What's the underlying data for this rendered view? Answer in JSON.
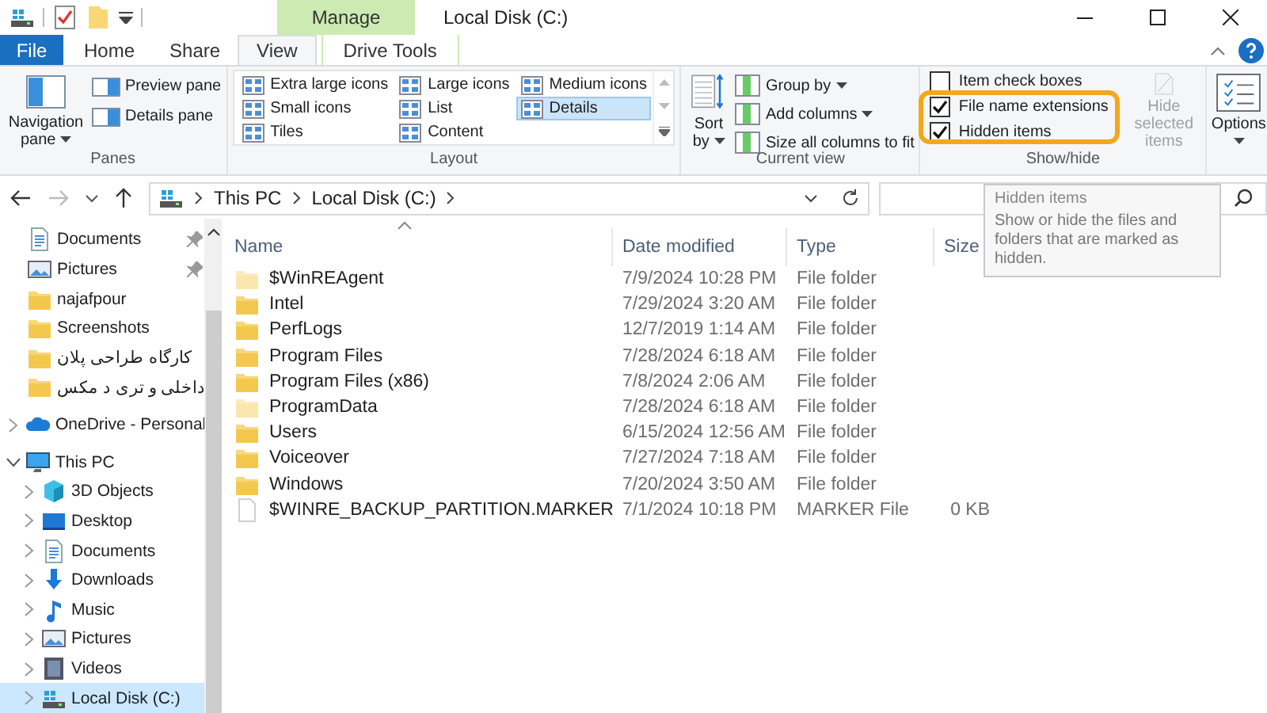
{
  "window": {
    "title": "Local Disk (C:)",
    "context_group": "Manage"
  },
  "tabs": [
    {
      "label": "File",
      "kind": "file",
      "selected": false
    },
    {
      "label": "Home",
      "kind": "normal",
      "selected": false
    },
    {
      "label": "Share",
      "kind": "normal",
      "selected": false
    },
    {
      "label": "View",
      "kind": "normal",
      "selected": true
    },
    {
      "label": "Drive Tools",
      "kind": "context",
      "selected": false
    }
  ],
  "ribbon": {
    "panes": {
      "title": "Panes",
      "large": "Navigation pane",
      "small": [
        "Preview pane",
        "Details pane"
      ]
    },
    "layout": {
      "title": "Layout",
      "options": [
        {
          "label": "Extra large icons",
          "selected": false
        },
        {
          "label": "Large icons",
          "selected": false
        },
        {
          "label": "Medium icons",
          "selected": false
        },
        {
          "label": "Small icons",
          "selected": false
        },
        {
          "label": "List",
          "selected": false
        },
        {
          "label": "Details",
          "selected": true
        },
        {
          "label": "Tiles",
          "selected": false
        },
        {
          "label": "Content",
          "selected": false
        }
      ]
    },
    "current_view": {
      "title": "Current view",
      "large": "Sort by",
      "small": [
        {
          "label": "Group by",
          "dropdown": true
        },
        {
          "label": "Add columns",
          "dropdown": true
        },
        {
          "label": "Size all columns to fit",
          "dropdown": false
        }
      ]
    },
    "show_hide": {
      "title": "Show/hide",
      "checkboxes": [
        {
          "label": "Item check boxes",
          "checked": false
        },
        {
          "label": "File name extensions",
          "checked": true
        },
        {
          "label": "Hidden items",
          "checked": true
        }
      ],
      "hide_selected": {
        "label": "Hide selected items",
        "disabled": true
      }
    },
    "options": {
      "label": "Options"
    }
  },
  "address": {
    "crumbs": [
      "This PC",
      "Local Disk (C:)"
    ]
  },
  "tooltip": {
    "title": "Hidden items",
    "text": "Show or hide the files and folders that are marked as hidden."
  },
  "quick_access": [
    {
      "label": "Documents",
      "kind": "documents",
      "pinned": true
    },
    {
      "label": "Pictures",
      "kind": "pictures",
      "pinned": true
    },
    {
      "label": "najafpour",
      "kind": "folder",
      "pinned": false
    },
    {
      "label": "Screenshots",
      "kind": "folder",
      "pinned": false
    },
    {
      "label": "کارگاه طراحی پلان",
      "kind": "folder",
      "pinned": false
    },
    {
      "label": "داخلی و تری د مکس",
      "kind": "folder",
      "pinned": false
    }
  ],
  "tree": [
    {
      "label": "OneDrive - Personal",
      "kind": "cloud",
      "expanded": false,
      "selected": false
    },
    {
      "label": "This PC",
      "kind": "computer",
      "expanded": true,
      "selected": false,
      "children": [
        {
          "label": "3D Objects",
          "kind": "objects",
          "expanded": false,
          "selected": false
        },
        {
          "label": "Desktop",
          "kind": "desktop",
          "expanded": false,
          "selected": false
        },
        {
          "label": "Documents",
          "kind": "documents",
          "expanded": false,
          "selected": false
        },
        {
          "label": "Downloads",
          "kind": "downloads",
          "expanded": false,
          "selected": false
        },
        {
          "label": "Music",
          "kind": "music",
          "expanded": false,
          "selected": false
        },
        {
          "label": "Pictures",
          "kind": "pictures",
          "expanded": false,
          "selected": false
        },
        {
          "label": "Videos",
          "kind": "videos",
          "expanded": false,
          "selected": false
        },
        {
          "label": "Local Disk (C:)",
          "kind": "drive",
          "expanded": false,
          "selected": true
        }
      ]
    }
  ],
  "table": {
    "columns": [
      "Name",
      "Date modified",
      "Type",
      "Size"
    ],
    "rows": [
      {
        "name": "$WinREAgent",
        "date": "7/9/2024 10:28 PM",
        "type": "File folder",
        "kind": "folder",
        "hidden": true
      },
      {
        "name": "Intel",
        "date": "7/29/2024 3:20 AM",
        "type": "File folder",
        "kind": "folder",
        "hidden": false
      },
      {
        "name": "PerfLogs",
        "date": "12/7/2019 1:14 AM",
        "type": "File folder",
        "kind": "folder",
        "hidden": false
      },
      {
        "name": "Program Files",
        "date": "7/28/2024 6:18 AM",
        "type": "File folder",
        "kind": "folder",
        "hidden": false
      },
      {
        "name": "Program Files (x86)",
        "date": "7/8/2024 2:06 AM",
        "type": "File folder",
        "kind": "folder",
        "hidden": false
      },
      {
        "name": "ProgramData",
        "date": "7/28/2024 6:18 AM",
        "type": "File folder",
        "kind": "folder",
        "hidden": true
      },
      {
        "name": "Users",
        "date": "6/15/2024 12:56 AM",
        "type": "File folder",
        "kind": "folder",
        "hidden": false
      },
      {
        "name": "Voiceover",
        "date": "7/27/2024 7:18 AM",
        "type": "File folder",
        "kind": "folder",
        "hidden": false
      },
      {
        "name": "Windows",
        "date": "7/20/2024 3:50 AM",
        "type": "File folder",
        "kind": "folder",
        "hidden": false
      },
      {
        "name": "$WINRE_BACKUP_PARTITION.MARKER",
        "date": "7/1/2024 10:18 PM",
        "type": "MARKER File",
        "size": "0 KB",
        "kind": "file",
        "hidden": true
      }
    ]
  }
}
